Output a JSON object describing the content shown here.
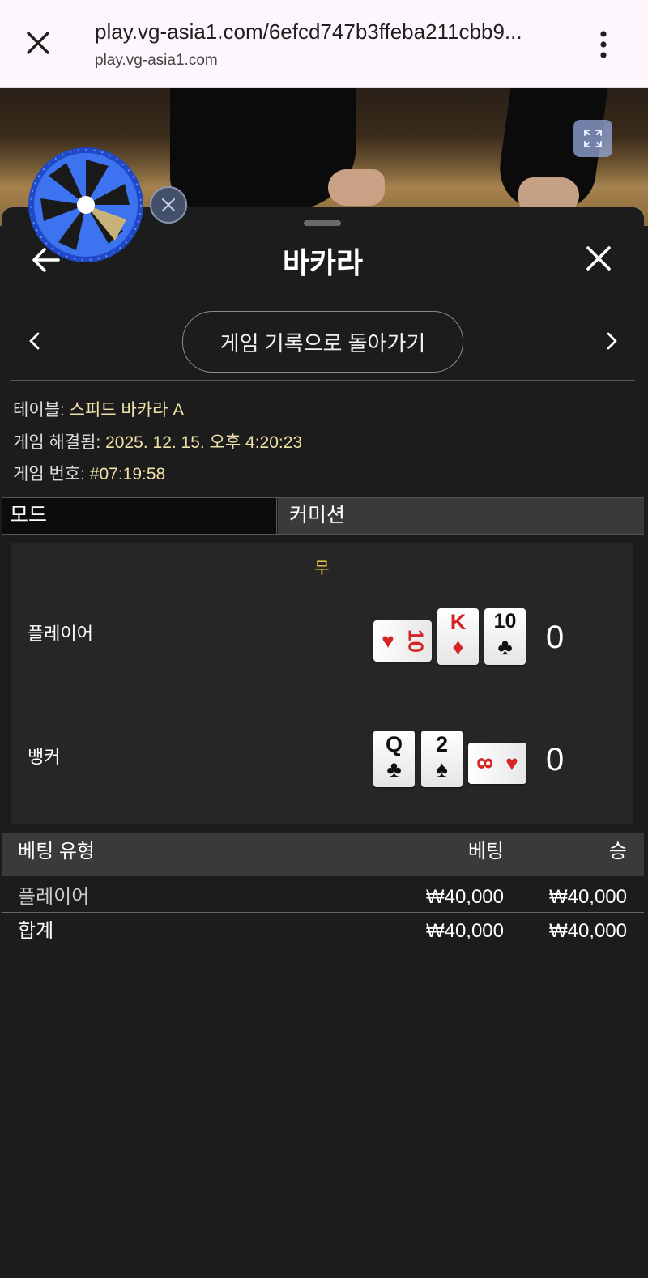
{
  "browser": {
    "url": "play.vg-asia1.com/6efcd747b3ffeba211cbb9...",
    "domain": "play.vg-asia1.com"
  },
  "sheet": {
    "title": "바카라",
    "back_to_history": "게임 기록으로 돌아가기"
  },
  "info": {
    "table_label": "테이블:",
    "table_value": "스피드 바카라 A",
    "resolved_label": "게임 해결됨:",
    "resolved_value": "2025. 12. 15. 오후 4:20:23",
    "game_no_label": "게임 번호:",
    "game_no_value": "#07:19:58"
  },
  "mode": {
    "label": "모드",
    "value": "커미션"
  },
  "result": {
    "outcome": "무",
    "player": {
      "label": "플레이어",
      "score": "0",
      "cards": [
        {
          "rank": "10",
          "suit": "♥",
          "color": "red",
          "orientation": "horizontal"
        },
        {
          "rank": "K",
          "suit": "♦",
          "color": "red",
          "orientation": "vertical"
        },
        {
          "rank": "10",
          "suit": "♣",
          "color": "black",
          "orientation": "vertical"
        }
      ]
    },
    "banker": {
      "label": "뱅커",
      "score": "0",
      "cards": [
        {
          "rank": "Q",
          "suit": "♣",
          "color": "black",
          "orientation": "vertical"
        },
        {
          "rank": "2",
          "suit": "♠",
          "color": "black",
          "orientation": "vertical"
        },
        {
          "rank": "8",
          "suit": "♥",
          "color": "red",
          "orientation": "horizontal"
        }
      ]
    }
  },
  "bets": {
    "headers": {
      "type": "베팅 유형",
      "bet": "베팅",
      "win": "승"
    },
    "rows": [
      {
        "type": "플레이어",
        "bet": "₩40,000",
        "win": "₩40,000"
      }
    ],
    "total": {
      "type": "합계",
      "bet": "₩40,000",
      "win": "₩40,000"
    }
  },
  "colors": {
    "outcome": "#ffd84a",
    "info_value": "#f0e1a8",
    "sheet_bg": "#1c1c1c"
  }
}
